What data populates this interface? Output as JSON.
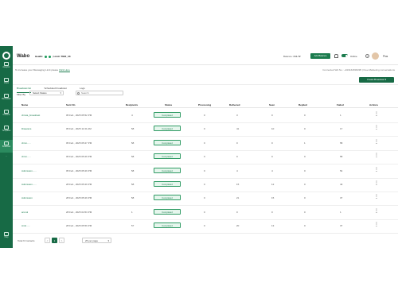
{
  "sidebar": {
    "items": [
      {
        "label": "Analytics"
      },
      {
        "label": "Chats"
      },
      {
        "label": "Bot Builder"
      },
      {
        "label": "Contacts"
      },
      {
        "label": "Templates"
      },
      {
        "label": "Broadcast"
      },
      {
        "label": "..."
      },
      {
        "label": "Help"
      }
    ]
  },
  "header": {
    "brand": "Wabo",
    "health_label": "Health:",
    "limit_text": "Limit: TIER_1K",
    "balance_label": "Balance:",
    "balance_value": "211.72",
    "add_balance": "Add Balance",
    "online_label": "Online",
    "user_name": "Plus"
  },
  "notice": {
    "text": "To increase your Messaging Limit please",
    "link": "Click Here",
    "connected": "Connected WA No.: +919162839395  |  Free Marketing conversations"
  },
  "tabs": [
    "Broadcast list",
    "Scheduled broadcast",
    "Logs"
  ],
  "create_button": "Create Broadcast",
  "filter": {
    "label": "Filter By",
    "select_value": "Select Status",
    "search_placeholder": "Search"
  },
  "table": {
    "columns": [
      "Name",
      "Sent On",
      "Recipients",
      "Status",
      "Processing",
      "Delivered",
      "Seen",
      "Replied",
      "Failed",
      "Actions"
    ],
    "rows": [
      {
        "name": "clinvia_broadcast",
        "sent_on": "05 Feb , 2025 05:52 PM",
        "recipients": "4",
        "status": "Completed",
        "processing": "0",
        "delivered": "3",
        "seen": "0",
        "replied": "0",
        "failed": "1"
      },
      {
        "name": "Disavans",
        "sent_on": "05 Feb , 2025 11:31 AM",
        "recipients": "58",
        "status": "Completed",
        "processing": "0",
        "delivered": "41",
        "seen": "10",
        "replied": "0",
        "failed": "17"
      },
      {
        "name": "clinvi......",
        "sent_on": "05 Feb , 2025 05:27 PM",
        "recipients": "58",
        "status": "Completed",
        "processing": "0",
        "delivered": "0",
        "seen": "0",
        "replied": "1",
        "failed": "58"
      },
      {
        "name": "clinvi......",
        "sent_on": "05 Feb , 2025 05:29 PM",
        "recipients": "58",
        "status": "Completed",
        "processing": "0",
        "delivered": "0",
        "seen": "0",
        "replied": "0",
        "failed": "58"
      },
      {
        "name": "Admission......",
        "sent_on": "05 Feb , 2025 05:29 PM",
        "recipients": "58",
        "status": "Completed",
        "processing": "0",
        "delivered": "4",
        "seen": "4",
        "replied": "0",
        "failed": "54"
      },
      {
        "name": "Admission......",
        "sent_on": "28 Feb , 2025 05:29 PM",
        "recipients": "58",
        "status": "Completed",
        "processing": "0",
        "delivered": "15",
        "seen": "12",
        "replied": "0",
        "failed": "43"
      },
      {
        "name": "Admission",
        "sent_on": "28 Feb , 2025 05:29 PM",
        "recipients": "58",
        "status": "Completed",
        "processing": "0",
        "delivered": "21",
        "seen": "15",
        "replied": "0",
        "failed": "37"
      },
      {
        "name": "anmol",
        "sent_on": "28 Feb , 2025 04:53 PM",
        "recipients": "1",
        "status": "Completed",
        "processing": "0",
        "delivered": "0",
        "seen": "0",
        "replied": "0",
        "failed": "1"
      },
      {
        "name": "Amit......",
        "sent_on": "28 Feb , 2025 05:59 PM",
        "recipients": "57",
        "status": "Completed",
        "processing": "0",
        "delivered": "20",
        "seen": "13",
        "replied": "0",
        "failed": "37"
      }
    ]
  },
  "footer": {
    "total": "Total 9 Contacts",
    "page_prev": "<",
    "page_current": "1",
    "page_next": ">",
    "per_page": "25 per page"
  },
  "colors": {
    "brand_green": "#176a45",
    "status_bg": "#e6f6ed"
  }
}
